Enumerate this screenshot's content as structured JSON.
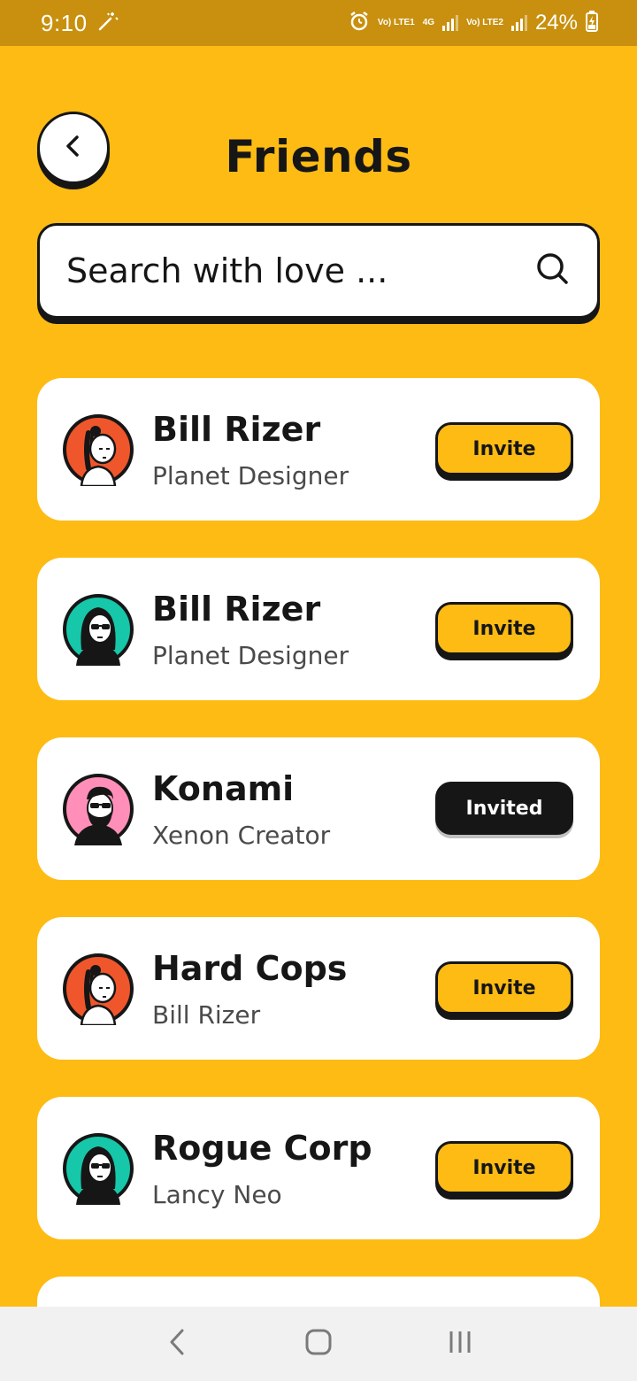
{
  "status_bar": {
    "time": "9:10",
    "sim1_label": "Vo) LTE1",
    "network_label": "4G",
    "sim2_label": "Vo) LTE2",
    "battery": "24%"
  },
  "header": {
    "title": "Friends"
  },
  "search": {
    "placeholder": "Search with love ..."
  },
  "friends": [
    {
      "name": "Bill Rizer",
      "role": "Planet Designer",
      "action": "Invite",
      "avatar": "girl-braid-avatar",
      "avatar_bg": "#F0562B",
      "invited": false
    },
    {
      "name": "Bill Rizer",
      "role": "Planet Designer",
      "action": "Invite",
      "avatar": "woman-sunglasses-avatar",
      "avatar_bg": "#16C7A9",
      "invited": false
    },
    {
      "name": "Konami",
      "role": "Xenon Creator",
      "action": "Invited",
      "avatar": "bearded-man-avatar",
      "avatar_bg": "#FF8FB8",
      "invited": true
    },
    {
      "name": "Hard Cops",
      "role": "Bill Rizer",
      "action": "Invite",
      "avatar": "girl-braid-avatar",
      "avatar_bg": "#F0562B",
      "invited": false
    },
    {
      "name": "Rogue Corp",
      "role": "Lancy Neo",
      "action": "Invite",
      "avatar": "woman-sunglasses-avatar",
      "avatar_bg": "#16C7A9",
      "invited": false
    }
  ],
  "colors": {
    "background": "#FDBB14",
    "status_bar": "#C8900E",
    "ink": "#161616",
    "card": "#FFFFFF"
  },
  "nav": {
    "back_icon": "chevron-left-icon",
    "home_icon": "home-square-icon",
    "recents_icon": "recent-apps-icon"
  }
}
